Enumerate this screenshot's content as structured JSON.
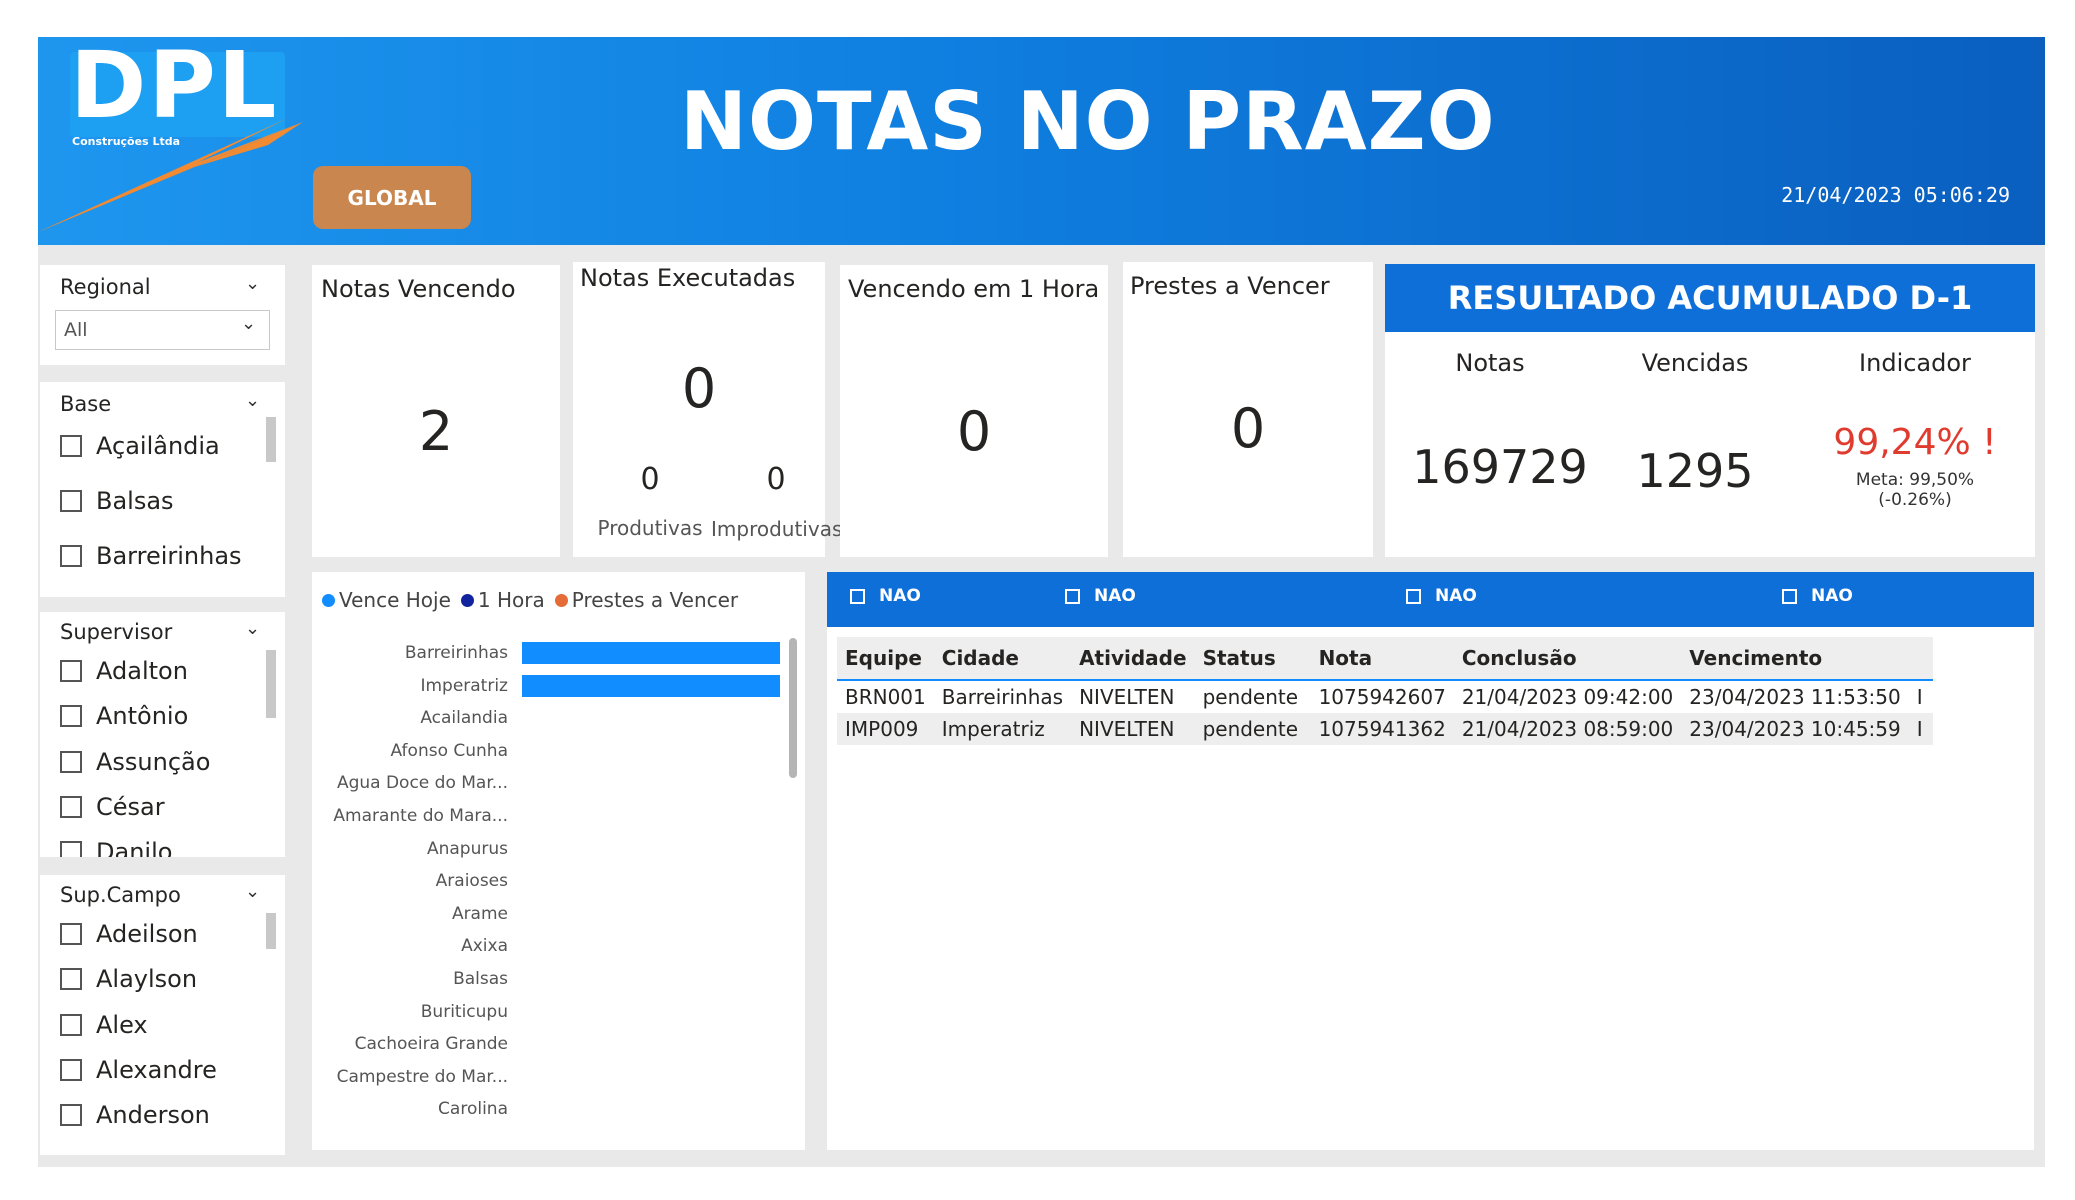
{
  "header": {
    "logo_text": "DPL",
    "logo_subtitle": "Construções Ltda",
    "title": "NOTAS NO PRAZO",
    "global_button": "GLOBAL",
    "datetime": "21/04/2023 05:06:29",
    "colors": {
      "header_start": "#1e96ee",
      "header_end": "#0a5fbf",
      "button": "#c9864f",
      "accent_orange": "#f28a32"
    }
  },
  "slicers": {
    "regional": {
      "title": "Regional",
      "selected": "All"
    },
    "base": {
      "title": "Base",
      "items": [
        "Açailândia",
        "Balsas",
        "Barreirinhas"
      ]
    },
    "supervisor": {
      "title": "Supervisor",
      "items": [
        "Adalton",
        "Antônio",
        "Assunção",
        "César",
        "Danilo"
      ]
    },
    "sup_campo": {
      "title": "Sup.Campo",
      "items": [
        "Adeilson",
        "Alaylson",
        "Alex",
        "Alexandre",
        "Anderson"
      ]
    }
  },
  "kpis": {
    "notas_vencendo": {
      "title": "Notas Vencendo",
      "value": "2"
    },
    "notas_executadas": {
      "title": "Notas Executadas",
      "value": "0",
      "produtivas": {
        "label": "Produtivas",
        "value": "0"
      },
      "improdutivas": {
        "label": "Improdutivas",
        "value": "0"
      }
    },
    "vencendo_1_hora": {
      "title": "Vencendo em 1 Hora",
      "value": "0"
    },
    "prestes_vencer": {
      "title": "Prestes a Vencer",
      "value": "0"
    }
  },
  "resultado": {
    "title": "RESULTADO ACUMULADO D-1",
    "columns": [
      "Notas",
      "Vencidas",
      "Indicador"
    ],
    "notas": "169729",
    "vencidas": "1295",
    "indicador": "99,24% !",
    "meta": "Meta: 99,50% (-0.26%)",
    "indicador_color": "#e03b2f"
  },
  "chart_data": {
    "type": "bar",
    "orientation": "horizontal",
    "legend": [
      "Vence Hoje",
      "1 Hora",
      "Prestes a Vencer"
    ],
    "legend_colors": [
      "#118dff",
      "#12239e",
      "#e66c37"
    ],
    "categories": [
      "Barreirinhas",
      "Imperatriz",
      "Acailandia",
      "Afonso Cunha",
      "Agua Doce do Mar...",
      "Amarante do Mara...",
      "Anapurus",
      "Araioses",
      "Arame",
      "Axixa",
      "Balsas",
      "Buriticupu",
      "Cachoeira Grande",
      "Campestre do Mar...",
      "Carolina"
    ],
    "series": [
      {
        "name": "Vence Hoje",
        "values": [
          1,
          1,
          0,
          0,
          0,
          0,
          0,
          0,
          0,
          0,
          0,
          0,
          0,
          0,
          0
        ]
      },
      {
        "name": "1 Hora",
        "values": [
          0,
          0,
          0,
          0,
          0,
          0,
          0,
          0,
          0,
          0,
          0,
          0,
          0,
          0,
          0
        ]
      },
      {
        "name": "Prestes a Vencer",
        "values": [
          0,
          0,
          0,
          0,
          0,
          0,
          0,
          0,
          0,
          0,
          0,
          0,
          0,
          0,
          0
        ]
      }
    ],
    "xlim": [
      0,
      1
    ]
  },
  "table": {
    "filters": [
      "NAO",
      "NAO",
      "NAO",
      "NAO"
    ],
    "columns": [
      "Equipe",
      "Cidade",
      "Atividade",
      "Status",
      "Nota",
      "Conclusão",
      "Vencimento"
    ],
    "rows": [
      [
        "BRN001",
        "Barreirinhas",
        "NIVELTEN",
        "pendente",
        "1075942607",
        "21/04/2023 09:42:00",
        "23/04/2023 11:53:50",
        "I"
      ],
      [
        "IMP009",
        "Imperatriz",
        "NIVELTEN",
        "pendente",
        "1075941362",
        "21/04/2023 08:59:00",
        "23/04/2023 10:45:59",
        "I"
      ]
    ]
  }
}
